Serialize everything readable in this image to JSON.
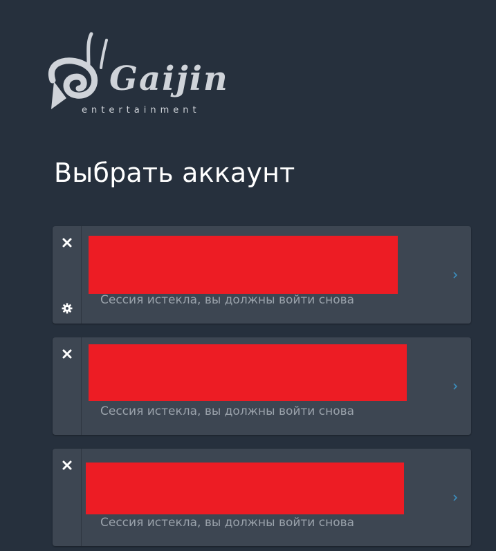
{
  "logo": {
    "brand": "Gaijin",
    "tagline": "entertainment"
  },
  "page": {
    "title": "Выбрать аккаунт"
  },
  "accounts": [
    {
      "status": "Сессия истекла, вы должны войти снова",
      "has_settings": true
    },
    {
      "status": "Сессия истекла, вы должны войти снова",
      "has_settings": false
    },
    {
      "status": "Сессия истекла, вы должны войти снова",
      "has_settings": false
    }
  ],
  "icons": {
    "remove": "close-icon",
    "settings": "gear-icon",
    "open": "chevron-right-icon"
  },
  "colors": {
    "background": "#26303d",
    "card": "#3d4652",
    "redaction": "#ed1c24",
    "chevron": "#3c8dbc",
    "status_text": "#9aa2ab"
  }
}
